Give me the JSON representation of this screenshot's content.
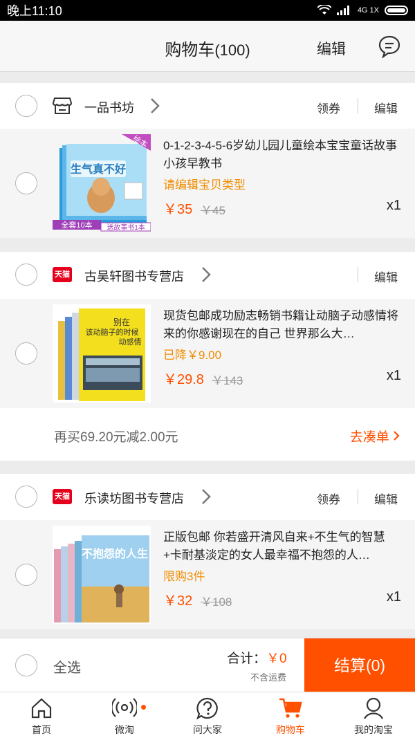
{
  "status_bar": {
    "time": "晚上11:10",
    "network": "4G 1X"
  },
  "header": {
    "title": "购物车",
    "count": "(100)",
    "edit": "编辑"
  },
  "shops": [
    {
      "name": "一品书坊",
      "coupon": "领券",
      "edit": "编辑",
      "item": {
        "title": "0-1-2-3-4-5-6岁幼儿园儿童绘本宝宝童话故事小孩早教书",
        "tag": "请编辑宝贝类型",
        "price": "￥35",
        "old_price": "￥45",
        "qty": "x1",
        "cover": {
          "corner": "绘本",
          "title": "生气真不好",
          "banner": "全套10本",
          "sub": "送故事书1本"
        }
      }
    },
    {
      "name": "古吴轩图书专营店",
      "badge": "天猫",
      "edit": "编辑",
      "item": {
        "title": "现货包邮成功励志畅销书籍让动脑子动感情将来的你感谢现在的自己 世界那么大…",
        "tag": "已降￥9.00",
        "price": "￥29.8",
        "old_price": "￥143",
        "qty": "x1",
        "cover": {
          "line1": "别在",
          "line2": "该动脑子的时候",
          "line3": "动感情"
        }
      },
      "promo": {
        "text": "再买69.20元减2.00元",
        "link": "去凑单"
      }
    },
    {
      "name": "乐读坊图书专营店",
      "badge": "天猫",
      "coupon": "领券",
      "edit": "编辑",
      "item": {
        "title": "正版包邮 你若盛开清风自来+不生气的智慧+卡耐基淡定的女人最幸福不抱怨的人…",
        "tag": "限购3件",
        "price": "￥32",
        "old_price": "￥108",
        "qty": "x1",
        "cover": {
          "title": "不抱怨的人生"
        }
      }
    }
  ],
  "footer": {
    "select_all": "全选",
    "total_label": "合计：",
    "total_value": "￥0",
    "shipping": "不含运费",
    "checkout": "结算(0)"
  },
  "tabs": [
    {
      "label": "首页",
      "icon": "home-icon"
    },
    {
      "label": "微淘",
      "icon": "broadcast-icon"
    },
    {
      "label": "问大家",
      "icon": "question-icon"
    },
    {
      "label": "购物车",
      "icon": "cart-icon",
      "active": true
    },
    {
      "label": "我的淘宝",
      "icon": "user-icon"
    }
  ],
  "colors": {
    "accent": "#ff5000",
    "tag": "#f08c00",
    "tmall": "#e4001c"
  }
}
